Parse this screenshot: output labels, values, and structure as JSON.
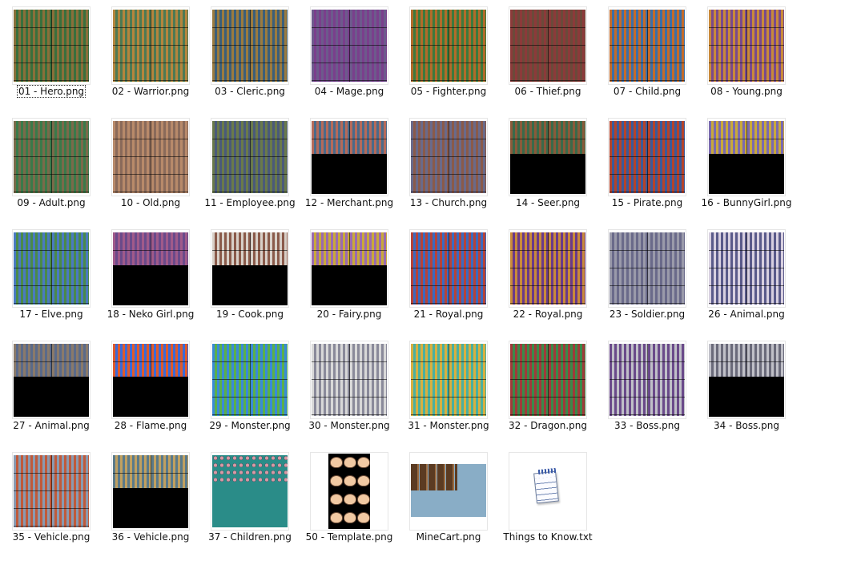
{
  "window": {
    "view": "large-icons"
  },
  "selected_index": 0,
  "files": [
    {
      "name": "01 - Hero.png",
      "palette": [
        "#8a6f3a",
        "#39703d",
        "#c9a170"
      ],
      "fill": 1.0
    },
    {
      "name": "02 - Warrior.png",
      "palette": [
        "#b5853d",
        "#4d7a54",
        "#d8b084"
      ],
      "fill": 1.0
    },
    {
      "name": "03 - Cleric.png",
      "palette": [
        "#9c7b3e",
        "#3b5f7a",
        "#d0a783"
      ],
      "fill": 1.0
    },
    {
      "name": "04 - Mage.png",
      "palette": [
        "#6d5a8c",
        "#7a3f8c",
        "#c9a8b8"
      ],
      "fill": 1.0
    },
    {
      "name": "05 - Fighter.png",
      "palette": [
        "#b26b2a",
        "#3d7a3d",
        "#d9a477"
      ],
      "fill": 1.0
    },
    {
      "name": "06 - Thief.png",
      "palette": [
        "#8c3a3a",
        "#6b4a3a",
        "#d3a07f"
      ],
      "fill": 1.0
    },
    {
      "name": "07 - Child.png",
      "palette": [
        "#c46b2a",
        "#3b6fa8",
        "#e3b48a"
      ],
      "fill": 1.0
    },
    {
      "name": "08 - Young.png",
      "palette": [
        "#c98a3a",
        "#7a4a8c",
        "#e2b789"
      ],
      "fill": 1.0
    },
    {
      "name": "09 - Adult.png",
      "palette": [
        "#7a6a4a",
        "#3a7a4a",
        "#caa07e"
      ],
      "fill": 1.0
    },
    {
      "name": "10 - Old.png",
      "palette": [
        "#b88a6a",
        "#8a6a5a",
        "#f0c8a8"
      ],
      "fill": 1.0
    },
    {
      "name": "11 - Employee.png",
      "palette": [
        "#6a7a4a",
        "#4a5a7a",
        "#caa07e"
      ],
      "fill": 1.0
    },
    {
      "name": "12 - Merchant.png",
      "palette": [
        "#b56a5a",
        "#4a6a8a",
        "#e0b7a0"
      ],
      "fill": 0.45
    },
    {
      "name": "13 - Church.png",
      "palette": [
        "#6a6a8a",
        "#8a5a4a",
        "#d7b59a"
      ],
      "fill": 1.0
    },
    {
      "name": "14 - Seer.png",
      "palette": [
        "#8a5a3a",
        "#3a6a4a",
        "#cfa482"
      ],
      "fill": 0.45
    },
    {
      "name": "15 - Pirate.png",
      "palette": [
        "#b5432a",
        "#3a5a9a",
        "#e0b08a"
      ],
      "fill": 1.0
    },
    {
      "name": "16 - BunnyGirl.png",
      "palette": [
        "#7a6ab0",
        "#c9a93a",
        "#e8c0b0"
      ],
      "fill": 0.45
    },
    {
      "name": "17 - Elve.png",
      "palette": [
        "#4a7ac0",
        "#4a8a4a",
        "#d8b8a0"
      ],
      "fill": 1.0
    },
    {
      "name": "18 - Neko Girl.png",
      "palette": [
        "#a05a8a",
        "#6a4a8a",
        "#e8c0b8"
      ],
      "fill": 0.45
    },
    {
      "name": "19 - Cook.png",
      "palette": [
        "#d8d0c8",
        "#8a5a4a",
        "#e8c8b0"
      ],
      "fill": 0.45
    },
    {
      "name": "20 - Fairy.png",
      "palette": [
        "#9a6ab0",
        "#c9a93a",
        "#e8c8b8"
      ],
      "fill": 0.45
    },
    {
      "name": "21 - Royal.png",
      "palette": [
        "#b5433a",
        "#3a6ac0",
        "#e0b08a"
      ],
      "fill": 1.0
    },
    {
      "name": "22 - Royal.png",
      "palette": [
        "#c98a3a",
        "#6a3a8a",
        "#e0b08a"
      ],
      "fill": 1.0
    },
    {
      "name": "23 - Soldier.png",
      "palette": [
        "#9a9aaa",
        "#6a6a8a",
        "#d0c0b8"
      ],
      "fill": 1.0
    },
    {
      "name": "26 - Animal.png",
      "palette": [
        "#d8d0e0",
        "#5a5a8a",
        "#f0e8f0"
      ],
      "fill": 1.0
    },
    {
      "name": "27 - Animal.png",
      "palette": [
        "#8a7a6a",
        "#5a6a8a",
        "#b09a8a"
      ],
      "fill": 0.45
    },
    {
      "name": "28 - Flame.png",
      "palette": [
        "#e05a2a",
        "#3a6ad8",
        "#f0c040"
      ],
      "fill": 0.45
    },
    {
      "name": "29 - Monster.png",
      "palette": [
        "#3a8ad8",
        "#5ab04a",
        "#e0883a"
      ],
      "fill": 1.0
    },
    {
      "name": "30 - Monster.png",
      "palette": [
        "#d8d8d8",
        "#8a8a9a",
        "#f0f0f0"
      ],
      "fill": 1.0
    },
    {
      "name": "31 - Monster.png",
      "palette": [
        "#d8b040",
        "#4ab0a0",
        "#e8c050"
      ],
      "fill": 1.0
    },
    {
      "name": "32 - Dragon.png",
      "palette": [
        "#a03a3a",
        "#3a8a4a",
        "#c05a4a"
      ],
      "fill": 1.0
    },
    {
      "name": "33 - Boss.png",
      "palette": [
        "#6a4a8a",
        "#c0c0c8",
        "#b04a4a"
      ],
      "fill": 1.0
    },
    {
      "name": "34 - Boss.png",
      "palette": [
        "#c0c0c8",
        "#6a6a7a",
        "#e0e0e8"
      ],
      "fill": 0.45
    },
    {
      "name": "35 - Vehicle.png",
      "palette": [
        "#8a9ab0",
        "#c05a3a",
        "#d8a040"
      ],
      "fill": 1.0
    },
    {
      "name": "36 - Vehicle.png",
      "palette": [
        "#5a7a8a",
        "#c0a060",
        "#8ab0c0"
      ],
      "fill": 0.45
    },
    {
      "name": "37 - Children.png",
      "palette": [
        "#2a8c88",
        "#2a8c88",
        "#d79aa5"
      ],
      "fill": 0.0,
      "kind": "teal"
    },
    {
      "name": "50 - Template.png",
      "palette": [
        "#000000",
        "#000000",
        "#f1c9a3"
      ],
      "fill": 0.0,
      "kind": "template"
    },
    {
      "name": "MineCart.png",
      "palette": [
        "#89adc6",
        "#5b3b22",
        "#9b6b40"
      ],
      "fill": 0.0,
      "kind": "minecart"
    },
    {
      "name": "Things to Know.txt",
      "palette": [
        "#ffffff",
        "#7187b4",
        "#3a5aa8"
      ],
      "fill": 0.0,
      "kind": "text"
    }
  ]
}
